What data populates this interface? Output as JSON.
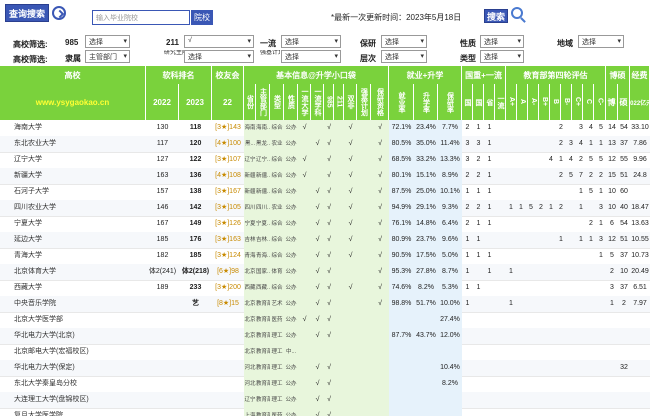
{
  "top": {
    "search_button": "查询搜索",
    "search_placeholder": "输入毕业院校",
    "school_button": "院校",
    "update_text": "*最新一次更新时间：2023年5月18日",
    "search2_button": "搜索"
  },
  "filters": {
    "row1_label": "高校筛选:",
    "row2_label": "高校筛选:",
    "f985": "985",
    "f211": "211",
    "fyiliu": "一流",
    "fbaoyan": "保研",
    "fxingzhi": "性质",
    "fdiqu": "地域",
    "flishu": "隶属",
    "fyanjiu": "研究生院",
    "fqiangji": "强基计划",
    "fcengci": "层次",
    "fleixing": "类型",
    "select_default": "选择",
    "select_211_value": "√",
    "select_lishu_value": "主管部门"
  },
  "header": {
    "col_school": "高校",
    "col_rank": "软科排名",
    "col_alumni": "校友会",
    "col_basic": "基本信息@升学小口袋",
    "col_job": "就业+升学",
    "col_domestic": "国重+一流",
    "col_eval": "教育部第四轮评估",
    "col_phd": "博硕",
    "col_fund": "经费",
    "site": "www.ysygaokao.cn",
    "y2022": "2022",
    "y2023": "2023",
    "y22": "22",
    "sheng": "省份",
    "zhuguan": "主管部门",
    "leixing": "类型",
    "xingzhi": "性质",
    "yiliu_daxue": "一流大学",
    "yiliu_xueke": "一流学科",
    "h985": "985",
    "h211": "211",
    "shuangfei": "双非",
    "qiangji": "强基计划",
    "baoyan": "保研资格",
    "jiuye": "就业率",
    "shengxue": "升学率",
    "baoyanlv": "保研率",
    "guo": "国",
    "guo2": "国",
    "sheng2": "省",
    "yiliu2": "一流",
    "eval_grades": [
      "A+",
      "A",
      "A-",
      "B+",
      "B",
      "B-",
      "C+",
      "C",
      "C-"
    ],
    "bo": "博",
    "shuo": "硕",
    "fund_year": "2022亿元"
  },
  "rows": [
    {
      "name": "海南大学",
      "r22": "130",
      "r23": "118",
      "alum": "[3★]143",
      "sh": "海南",
      "zg": "海南..",
      "lx": "综合",
      "xz": "公办",
      "c1": "√",
      "c2": "",
      "c3": "√",
      "c4": "",
      "c5": "√",
      "c6": "",
      "c7": "√",
      "jy": "72.1%",
      "sx": "23.4%",
      "by": "7.7%",
      "d1": "2",
      "d2": "1",
      "d3": "1",
      "d4": "",
      "e": [
        "",
        "",
        "",
        "",
        "",
        "2",
        "",
        "3",
        "4",
        "5"
      ],
      "bo": "14",
      "shuo": "54",
      "fund": "33.10"
    },
    {
      "name": "东北农业大学",
      "r22": "117",
      "r23": "120",
      "alum": "[4★]100",
      "sh": "黑...",
      "zg": "黑龙..",
      "lx": "农业",
      "xz": "公办",
      "c1": "",
      "c2": "√",
      "c3": "√",
      "c4": "",
      "c5": "√",
      "c6": "",
      "c7": "√",
      "jy": "80.5%",
      "sx": "35.0%",
      "by": "11.4%",
      "d1": "3",
      "d2": "3",
      "d3": "1",
      "d4": "",
      "e": [
        "",
        "",
        "",
        "",
        "",
        "2",
        "3",
        "4",
        "1",
        "1"
      ],
      "bo": "13",
      "shuo": "37",
      "fund": "7.86"
    },
    {
      "name": "辽宁大学",
      "r22": "127",
      "r23": "122",
      "alum": "[3★]107",
      "sh": "辽宁",
      "zg": "辽宁..",
      "lx": "综合",
      "xz": "公办",
      "c1": "√",
      "c2": "",
      "c3": "√",
      "c4": "",
      "c5": "√",
      "c6": "",
      "c7": "√",
      "jy": "68.5%",
      "sx": "33.2%",
      "by": "13.3%",
      "d1": "3",
      "d2": "2",
      "d3": "1",
      "d4": "",
      "e": [
        "",
        "",
        "",
        "",
        "4",
        "1",
        "4",
        "2",
        "5",
        "5"
      ],
      "bo": "12",
      "shuo": "55",
      "fund": "9.96"
    },
    {
      "name": "新疆大学",
      "r22": "163",
      "r23": "136",
      "alum": "[4★]108",
      "sh": "新疆",
      "zg": "新疆..",
      "lx": "综合",
      "xz": "公办",
      "c1": "√",
      "c2": "",
      "c3": "√",
      "c4": "",
      "c5": "√",
      "c6": "",
      "c7": "√",
      "jy": "80.1%",
      "sx": "15.1%",
      "by": "8.9%",
      "d1": "2",
      "d2": "2",
      "d3": "1",
      "d4": "",
      "e": [
        "",
        "",
        "",
        "",
        "",
        "2",
        "5",
        "7",
        "2",
        "2"
      ],
      "bo": "15",
      "shuo": "51",
      "fund": "24.8"
    },
    {
      "name": "石河子大学",
      "r22": "157",
      "r23": "138",
      "alum": "[3★]167",
      "sh": "新疆",
      "zg": "新疆..",
      "lx": "综合",
      "xz": "公办",
      "c1": "",
      "c2": "√",
      "c3": "√",
      "c4": "",
      "c5": "√",
      "c6": "",
      "c7": "√",
      "jy": "87.5%",
      "sx": "25.0%",
      "by": "10.1%",
      "d1": "1",
      "d2": "1",
      "d3": "1",
      "d4": "",
      "e": [
        "",
        "",
        "",
        "",
        "",
        "",
        "",
        "1",
        "5",
        "1"
      ],
      "bo": "10",
      "shuo": "60",
      "fund": ""
    },
    {
      "name": "四川农业大学",
      "r22": "146",
      "r23": "142",
      "alum": "[3★]105",
      "sh": "四川",
      "zg": "四川..",
      "lx": "农业",
      "xz": "公办",
      "c1": "",
      "c2": "√",
      "c3": "√",
      "c4": "",
      "c5": "√",
      "c6": "",
      "c7": "√",
      "jy": "94.9%",
      "sx": "29.1%",
      "by": "9.3%",
      "d1": "2",
      "d2": "2",
      "d3": "1",
      "d4": "",
      "e": [
        "1",
        "1",
        "5",
        "2",
        "1",
        "2",
        "",
        "1",
        "",
        "3"
      ],
      "bo": "10",
      "shuo": "40",
      "fund": "18.47"
    },
    {
      "name": "宁夏大学",
      "r22": "167",
      "r23": "149",
      "alum": "[3★]126",
      "sh": "宁夏",
      "zg": "宁夏..",
      "lx": "综合",
      "xz": "公办",
      "c1": "",
      "c2": "√",
      "c3": "√",
      "c4": "",
      "c5": "√",
      "c6": "",
      "c7": "√",
      "jy": "76.1%",
      "sx": "14.8%",
      "by": "6.4%",
      "d1": "2",
      "d2": "1",
      "d3": "1",
      "d4": "",
      "e": [
        "",
        "",
        "",
        "",
        "",
        "",
        "",
        "",
        "2",
        "1"
      ],
      "bo": "6",
      "shuo": "54",
      "fund": "13.63"
    },
    {
      "name": "延边大学",
      "r22": "185",
      "r23": "176",
      "alum": "[3★]163",
      "sh": "吉林",
      "zg": "吉林..",
      "lx": "综合",
      "xz": "公办",
      "c1": "",
      "c2": "√",
      "c3": "√",
      "c4": "",
      "c5": "√",
      "c6": "",
      "c7": "√",
      "jy": "80.9%",
      "sx": "23.7%",
      "by": "9.6%",
      "d1": "1",
      "d2": "1",
      "d3": "",
      "d4": "",
      "e": [
        "",
        "",
        "",
        "",
        "",
        "1",
        "",
        "1",
        "1",
        "3"
      ],
      "bo": "12",
      "shuo": "51",
      "fund": "10.55"
    },
    {
      "name": "青海大学",
      "r22": "182",
      "r23": "185",
      "alum": "[3★]124",
      "sh": "青海",
      "zg": "青海..",
      "lx": "综合",
      "xz": "公办",
      "c1": "",
      "c2": "√",
      "c3": "√",
      "c4": "",
      "c5": "√",
      "c6": "",
      "c7": "√",
      "jy": "90.5%",
      "sx": "17.5%",
      "by": "5.0%",
      "d1": "1",
      "d2": "1",
      "d3": "1",
      "d4": "",
      "e": [
        "",
        "",
        "",
        "",
        "",
        "",
        "",
        "",
        "",
        "1"
      ],
      "bo": "5",
      "shuo": "37",
      "fund": "10.73"
    },
    {
      "name": "北京体育大学",
      "r22": "体2(241)",
      "r23": "体2(218)",
      "alum": "[6★]98",
      "sh": "北京",
      "zg": "国家..",
      "lx": "体育",
      "xz": "公办",
      "c1": "",
      "c2": "√",
      "c3": "√",
      "c4": "",
      "c5": "",
      "c6": "",
      "c7": "√",
      "jy": "95.3%",
      "sx": "27.8%",
      "by": "8.7%",
      "d1": "1",
      "d2": "",
      "d3": "1",
      "d4": "",
      "e": [
        "1",
        "",
        "",
        "",
        "",
        "",
        "",
        "",
        "",
        ""
      ],
      "bo": "2",
      "shuo": "10",
      "fund": "20.49"
    },
    {
      "name": "西藏大学",
      "r22": "189",
      "r23": "233",
      "alum": "[3★]200",
      "sh": "西藏",
      "zg": "西藏..",
      "lx": "综合",
      "xz": "公办",
      "c1": "",
      "c2": "√",
      "c3": "√",
      "c4": "",
      "c5": "√",
      "c6": "",
      "c7": "√",
      "jy": "74.6%",
      "sx": "8.2%",
      "by": "5.3%",
      "d1": "1",
      "d2": "1",
      "d3": "",
      "d4": "",
      "e": [
        "",
        "",
        "",
        "",
        "",
        "",
        "",
        "",
        "",
        ""
      ],
      "bo": "3",
      "shuo": "37",
      "fund": "6.51"
    },
    {
      "name": "中央音乐学院",
      "r22": "",
      "r23": "艺",
      "alum": "[8★]15",
      "sh": "北京",
      "zg": "教育部",
      "lx": "艺术",
      "xz": "公办",
      "c1": "",
      "c2": "√",
      "c3": "√",
      "c4": "",
      "c5": "",
      "c6": "",
      "c7": "√",
      "jy": "98.8%",
      "sx": "51.7%",
      "by": "10.0%",
      "d1": "1",
      "d2": "",
      "d3": "",
      "d4": "",
      "e": [
        "1",
        "",
        "",
        "",
        "",
        "",
        "",
        "",
        "",
        ""
      ],
      "bo": "1",
      "shuo": "2",
      "fund": "7.97"
    },
    {
      "name": "北京大学医学部",
      "r22": "",
      "r23": "",
      "alum": "",
      "sh": "北京",
      "zg": "教育部",
      "lx": "医药",
      "xz": "公办",
      "c1": "√",
      "c2": "√",
      "c3": "√",
      "c4": "",
      "c5": "",
      "c6": "",
      "c7": "",
      "jy": "",
      "sx": "",
      "by": "27.4%",
      "d1": "",
      "d2": "",
      "d3": "",
      "d4": "",
      "e": [
        "",
        "",
        "",
        "",
        "",
        "",
        "",
        "",
        "",
        ""
      ],
      "bo": "",
      "shuo": "",
      "fund": ""
    },
    {
      "name": "华北电力大学(北京)",
      "r22": "",
      "r23": "",
      "alum": "",
      "sh": "北京",
      "zg": "教育部",
      "lx": "理工",
      "xz": "公办",
      "c1": "",
      "c2": "√",
      "c3": "√",
      "c4": "",
      "c5": "",
      "c6": "",
      "c7": "",
      "jy": "87.7%",
      "sx": "43.7%",
      "by": "12.0%",
      "d1": "",
      "d2": "",
      "d3": "",
      "d4": "",
      "e": [
        "",
        "",
        "",
        "",
        "",
        "",
        "",
        "",
        "",
        ""
      ],
      "bo": "",
      "shuo": "",
      "fund": ""
    },
    {
      "name": "北京邮电大学(宏福校区)",
      "r22": "",
      "r23": "",
      "alum": "",
      "sh": "北京",
      "zg": "教育部",
      "lx": "理工",
      "xz": "中...",
      "c1": "",
      "c2": "",
      "c3": "",
      "c4": "",
      "c5": "",
      "c6": "",
      "c7": "",
      "jy": "",
      "sx": "",
      "by": "",
      "d1": "",
      "d2": "",
      "d3": "",
      "d4": "",
      "e": [
        "",
        "",
        "",
        "",
        "",
        "",
        "",
        "",
        "",
        ""
      ],
      "bo": "",
      "shuo": "",
      "fund": ""
    },
    {
      "name": "华北电力大学(保定)",
      "r22": "",
      "r23": "",
      "alum": "",
      "sh": "河北",
      "zg": "教育部",
      "lx": "理工",
      "xz": "公办",
      "c1": "",
      "c2": "√",
      "c3": "√",
      "c4": "",
      "c5": "",
      "c6": "",
      "c7": "",
      "jy": "",
      "sx": "",
      "by": "10.4%",
      "d1": "",
      "d2": "",
      "d3": "",
      "d4": "",
      "e": [
        "",
        "",
        "",
        "",
        "",
        "",
        "",
        "",
        "",
        ""
      ],
      "bo": "",
      "shuo": "32",
      "fund": ""
    },
    {
      "name": "东北大学秦皇岛分校",
      "r22": "",
      "r23": "",
      "alum": "",
      "sh": "河北",
      "zg": "教育部",
      "lx": "理工",
      "xz": "公办",
      "c1": "",
      "c2": "√",
      "c3": "√",
      "c4": "",
      "c5": "",
      "c6": "",
      "c7": "",
      "jy": "",
      "sx": "",
      "by": "8.2%",
      "d1": "",
      "d2": "",
      "d3": "",
      "d4": "",
      "e": [
        "",
        "",
        "",
        "",
        "",
        "",
        "",
        "",
        "",
        ""
      ],
      "bo": "",
      "shuo": "",
      "fund": ""
    },
    {
      "name": "大连理工大学(盘锦校区)",
      "r22": "",
      "r23": "",
      "alum": "",
      "sh": "辽宁",
      "zg": "教育部",
      "lx": "理工",
      "xz": "公办",
      "c1": "",
      "c2": "√",
      "c3": "√",
      "c4": "",
      "c5": "",
      "c6": "",
      "c7": "",
      "jy": "",
      "sx": "",
      "by": "",
      "d1": "",
      "d2": "",
      "d3": "",
      "d4": "",
      "e": [
        "",
        "",
        "",
        "",
        "",
        "",
        "",
        "",
        "",
        ""
      ],
      "bo": "",
      "shuo": "",
      "fund": ""
    },
    {
      "name": "复旦大学医学院",
      "r22": "",
      "r23": "",
      "alum": "",
      "sh": "上海",
      "zg": "教育部",
      "lx": "医药",
      "xz": "公办",
      "c1": "",
      "c2": "√",
      "c3": "√",
      "c4": "",
      "c5": "",
      "c6": "",
      "c7": "",
      "jy": "",
      "sx": "",
      "by": "",
      "d1": "",
      "d2": "",
      "d3": "",
      "d4": "",
      "e": [
        "",
        "",
        "",
        "",
        "",
        "",
        "",
        "",
        "",
        ""
      ],
      "bo": "",
      "shuo": "",
      "fund": ""
    }
  ]
}
